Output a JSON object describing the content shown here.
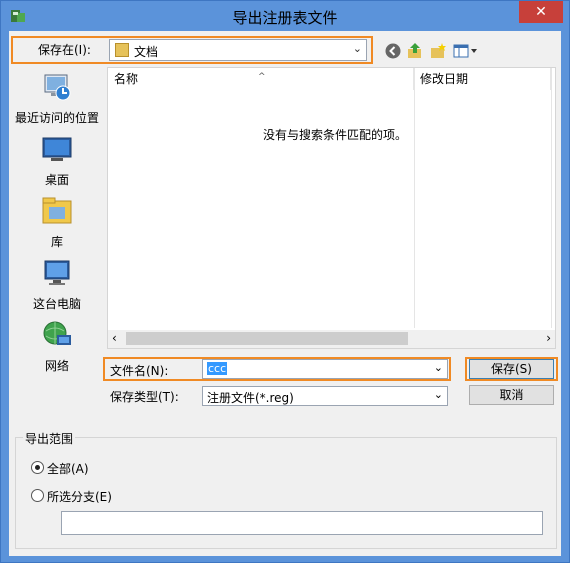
{
  "window": {
    "title": "导出注册表文件",
    "close_glyph": "✕"
  },
  "save_in": {
    "label": "保存在(I):",
    "value": "文档"
  },
  "places": [
    {
      "label": "最近访问的位置",
      "icon": "recent-places-icon"
    },
    {
      "label": "桌面",
      "icon": "desktop-icon"
    },
    {
      "label": "库",
      "icon": "libraries-icon"
    },
    {
      "label": "这台电脑",
      "icon": "this-pc-icon"
    },
    {
      "label": "网络",
      "icon": "network-icon"
    }
  ],
  "list": {
    "columns": [
      "名称",
      "修改日期"
    ],
    "empty_message": "没有与搜索条件匹配的项。"
  },
  "file_name": {
    "label": "文件名(N):",
    "value": "ccc"
  },
  "file_type": {
    "label": "保存类型(T):",
    "value": "注册文件(*.reg)"
  },
  "buttons": {
    "save": "保存(S)",
    "cancel": "取消"
  },
  "export_range": {
    "title": "导出范围",
    "options": [
      {
        "label": "全部(A)",
        "selected": true
      },
      {
        "label": "所选分支(E)",
        "selected": false
      }
    ],
    "branch_value": ""
  },
  "colors": {
    "highlight": "#f08a24",
    "title_bar": "#5b93da",
    "selection": "#3399ff"
  }
}
